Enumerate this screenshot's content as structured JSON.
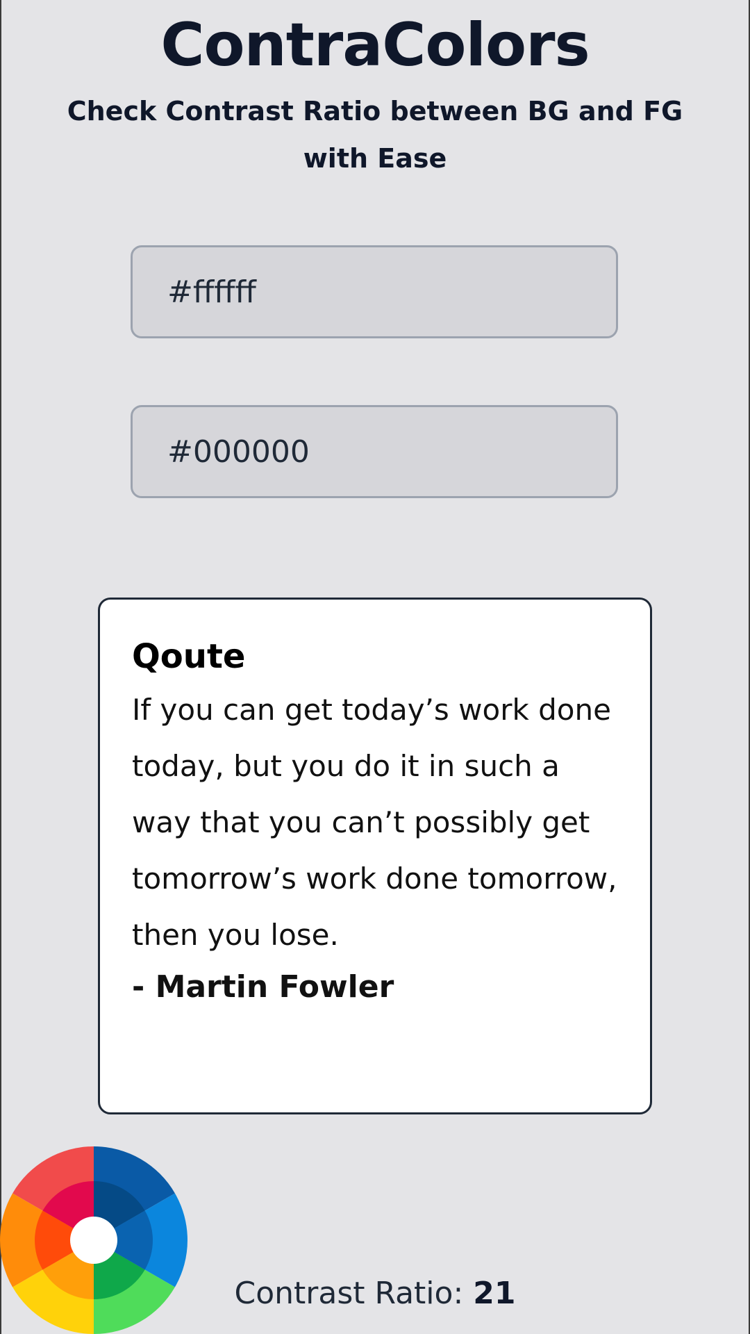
{
  "header": {
    "title": "ContraColors",
    "subtitle": "Check Contrast Ratio between BG and FG with Ease"
  },
  "inputs": {
    "background_value": "#ffffff",
    "foreground_value": "#000000"
  },
  "quote": {
    "heading": "Qoute",
    "text": "If you can get today’s work done today, but you do it in such a way that you can’t possibly get tomorrow’s work done tomorrow, then you lose.",
    "author": "- Martin Fowler"
  },
  "result": {
    "label": "Contrast Ratio: ",
    "value": "21"
  },
  "icons": {
    "color_wheel": "color-wheel-icon"
  },
  "colors": {
    "page_background": "#e4e4e7",
    "card_background": "#ffffff",
    "text_dark": "#0f172a"
  }
}
